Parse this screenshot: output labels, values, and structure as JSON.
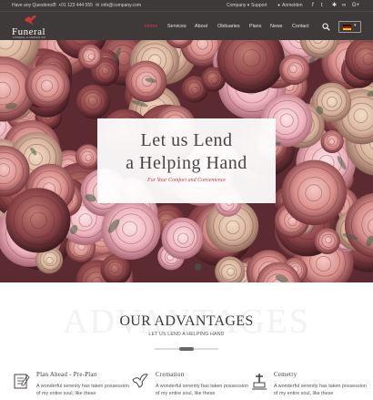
{
  "topbar": {
    "question": "Have any Questions?",
    "phone": "+01 123 444 555",
    "email": "info@company.com",
    "company_menu": "Company",
    "support": "Support",
    "login": "Anmelden",
    "social": [
      {
        "icon": "facebook-icon",
        "glyph": "f"
      },
      {
        "icon": "twitter-icon",
        "glyph": "t"
      },
      {
        "icon": "yelp-icon",
        "glyph": "✱"
      },
      {
        "icon": "tripadvisor-icon",
        "glyph": "∞"
      },
      {
        "icon": "google-plus-icon",
        "glyph": "G+"
      }
    ]
  },
  "header": {
    "logo_text": "Funeral",
    "logo_subtext": "FUNERAL & CREMATION",
    "nav": [
      "Home",
      "Services",
      "About",
      "Obituaries",
      "Plans",
      "News",
      "Contact"
    ],
    "active_nav": "Home",
    "language_flag": "german-flag"
  },
  "hero": {
    "title_line1": "Let us Lend",
    "title_line2": "a Helping Hand",
    "subtitle": "For Your Comfort and Convenience"
  },
  "advantages": {
    "watermark": "ADVANTAGES",
    "title": "OUR ADVANTAGES",
    "subtitle": "LET US LEND A HELPING HAND",
    "features": [
      {
        "icon": "plan-book-icon",
        "title": "Plan Ahead - Pre-Plan",
        "text": "A wonderful serenity has taken possession of my entire soul, like these"
      },
      {
        "icon": "dove-icon",
        "title": "Cremation",
        "text": "A wonderful serenity has taken possession of my entire soul, like these"
      },
      {
        "icon": "tombstone-icon",
        "title": "Cemetry",
        "text": "A wonderful serenity has taken possession of my entire soul, like these"
      }
    ]
  },
  "colors": {
    "accent": "#d0373d",
    "header_bg": "#3f3a3a",
    "text_dark": "#3f3a3a"
  }
}
